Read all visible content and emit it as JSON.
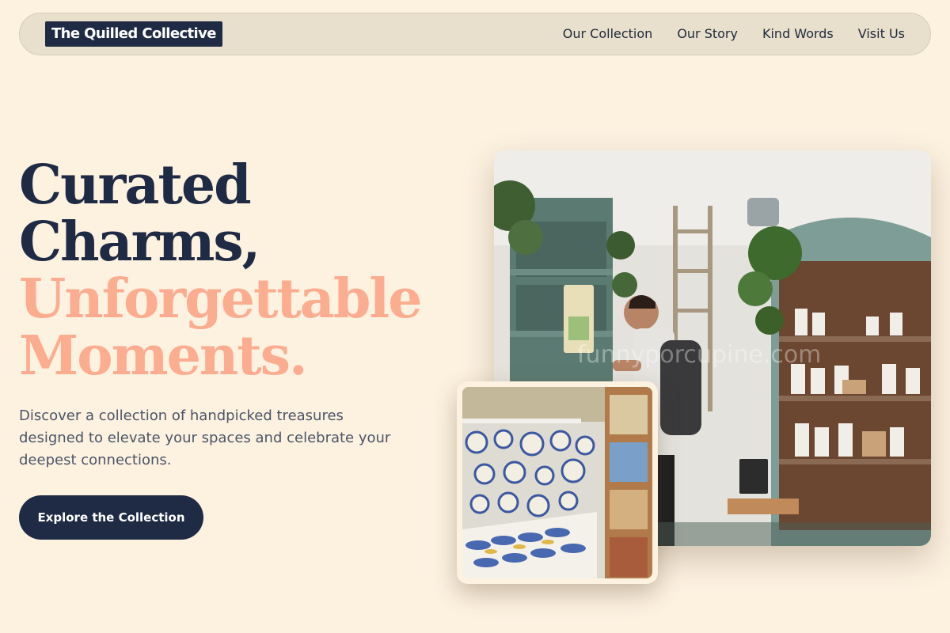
{
  "brand": {
    "logo_text": "The Quilled Collective"
  },
  "nav": {
    "items": [
      {
        "label": "Our Collection"
      },
      {
        "label": "Our Story"
      },
      {
        "label": "Kind Words"
      },
      {
        "label": "Visit Us"
      }
    ]
  },
  "hero": {
    "headline_line1": "Curated",
    "headline_line2": "Charms,",
    "headline_line3": "Unforgettable",
    "headline_line4": "Moments.",
    "subtext": "Discover a collection of handpicked treasures designed to elevate your spaces and celebrate your deepest connections.",
    "cta_label": "Explore the Collection"
  },
  "images": {
    "main_photo": "boutique-shop-interior-photo",
    "secondary_photo": "ceramic-plates-wall-display-photo",
    "watermark_text": "funnyporcupine.com"
  },
  "colors": {
    "background": "#fdf1e0",
    "nav_background": "#e8dfcc",
    "navy": "#1f2a44",
    "peach_accent": "#fcad90",
    "body_text": "#4a5568"
  }
}
